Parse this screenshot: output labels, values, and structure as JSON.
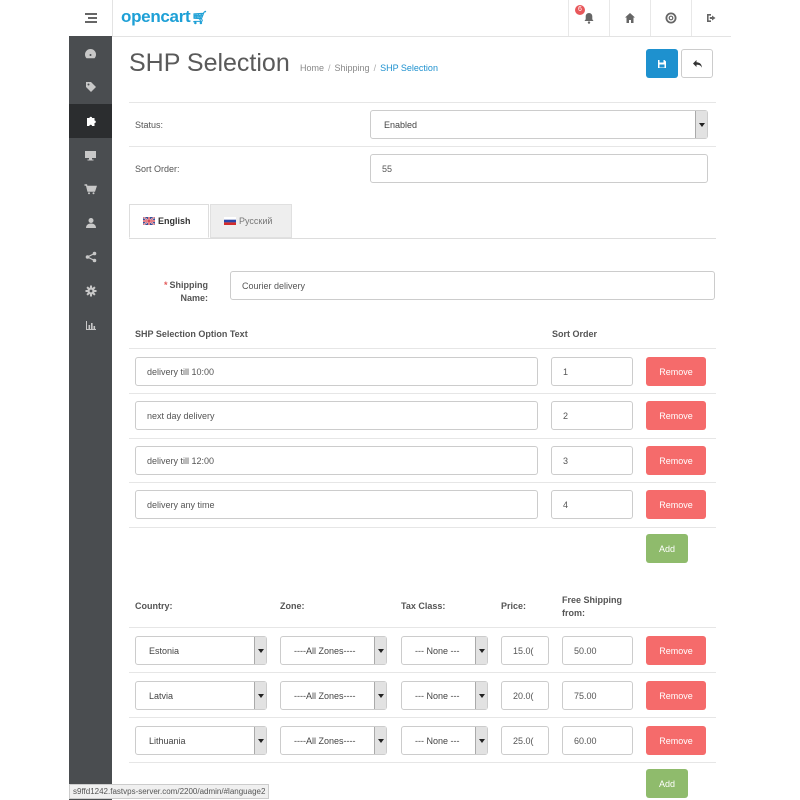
{
  "header": {
    "brand": "opencart",
    "notification_count": "6"
  },
  "sidebar": {
    "items": [
      {
        "icon": "dashboard-icon",
        "active": false
      },
      {
        "icon": "tag-icon",
        "active": false
      },
      {
        "icon": "puzzle-icon",
        "active": true
      },
      {
        "icon": "monitor-icon",
        "active": false
      },
      {
        "icon": "cart-icon",
        "active": false
      },
      {
        "icon": "user-icon",
        "active": false
      },
      {
        "icon": "share-icon",
        "active": false
      },
      {
        "icon": "gear-icon",
        "active": false
      },
      {
        "icon": "bar-chart-icon",
        "active": false
      }
    ]
  },
  "page": {
    "title": "SHP Selection",
    "breadcrumb": [
      "Home",
      "Shipping",
      "SHP Selection"
    ],
    "breadcrumb_sep": "/"
  },
  "form": {
    "status_label": "Status:",
    "status_value": "Enabled",
    "sort_order_label": "Sort Order:",
    "sort_order_value": "55"
  },
  "tabs": [
    {
      "label": "English",
      "active": true
    },
    {
      "label": "Русский",
      "active": false
    }
  ],
  "shipping_name": {
    "label_line1": "Shipping",
    "label_line2": "Name:",
    "required_mark": "*",
    "value": "Courier delivery"
  },
  "options": {
    "col_text": "SHP Selection Option Text",
    "col_sort": "Sort Order",
    "remove_label": "Remove",
    "add_label": "Add",
    "rows": [
      {
        "text": "delivery till 10:00",
        "sort": "1"
      },
      {
        "text": "next day delivery",
        "sort": "2"
      },
      {
        "text": "delivery till 12:00",
        "sort": "3"
      },
      {
        "text": "delivery any time",
        "sort": "4"
      }
    ]
  },
  "rates": {
    "col_country": "Country:",
    "col_zone": "Zone:",
    "col_tax": "Tax Class:",
    "col_price": "Price:",
    "col_free_line1": "Free Shipping",
    "col_free_line2": "from:",
    "remove_label": "Remove",
    "add_label": "Add",
    "rows": [
      {
        "country": "Estonia",
        "zone": "----All Zones----",
        "tax": "--- None ---",
        "price": "15.0(",
        "free": "50.00"
      },
      {
        "country": "Latvia",
        "zone": "----All Zones----",
        "tax": "--- None ---",
        "price": "20.0(",
        "free": "75.00"
      },
      {
        "country": "Lithuania",
        "zone": "----All Zones----",
        "tax": "--- None ---",
        "price": "25.0(",
        "free": "60.00"
      }
    ]
  },
  "status_bar": {
    "url": "s9ffd1242.fastvps-server.com/2200/admin/#language2"
  },
  "colors": {
    "primary": "#1e91cf",
    "danger": "#f56b6b",
    "success": "#8fbb6c",
    "sidebar": "#4a4d50"
  }
}
